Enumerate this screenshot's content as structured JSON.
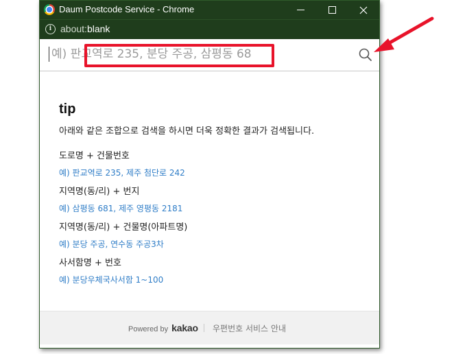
{
  "window": {
    "title": "Daum Postcode Service - Chrome",
    "url_scheme": "about:",
    "url_path": "blank"
  },
  "search": {
    "placeholder": "예) 판교역로 235, 분당 주공, 삼평동 68",
    "value": ""
  },
  "tips": {
    "title": "tip",
    "description": "아래와 같은 조합으로 검색을 하시면 더욱 정확한 결과가 검색됩니다.",
    "items": [
      {
        "head": "도로명 + 건물번호",
        "example": "예) 판교역로 235,  제주 첨단로 242"
      },
      {
        "head": "지역명(동/리) + 번지",
        "example": "예) 삼평동 681,  제주 영평동 2181"
      },
      {
        "head": "지역명(동/리) + 건물명(아파트명)",
        "example": "예) 분당 주공,  연수동 주공3차"
      },
      {
        "head": "사서함명 + 번호",
        "example": "예) 분당우체국사서함 1~100"
      }
    ]
  },
  "footer": {
    "powered_by": "Powered by",
    "brand": "kakao",
    "link": "우편번호 서비스 안내"
  },
  "colors": {
    "titlebar": "#1f3d1c",
    "highlight": "#e8132a",
    "example_text": "#2f7dc7"
  }
}
